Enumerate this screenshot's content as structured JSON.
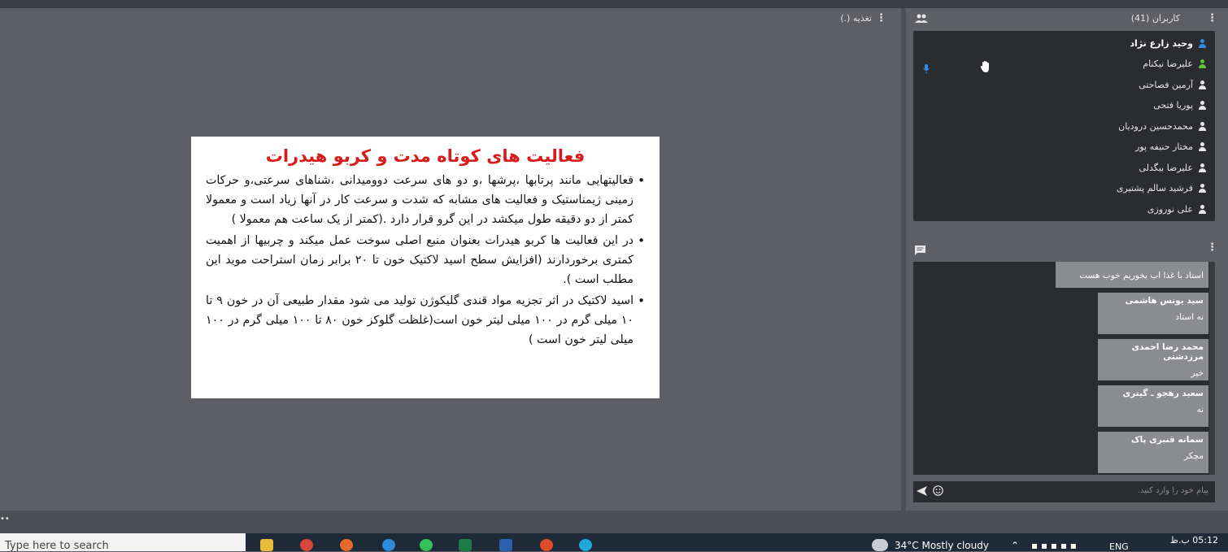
{
  "main": {
    "title": "تغذیه (.)"
  },
  "slide": {
    "title": "فعالیت های کوتاه مدت و کربو هیدرات",
    "bullets": [
      "فعالیتهایی مانند پرتابها ،پرشها ،و دو های سرعت دوومیدانی ،شناهای سرعتی،و حرکات زمینی ژیمناستیک و فعالیت های مشابه که شدت و سرعت کار در آنها زیاد است و معمولا کمتر از دو دقیقه طول میکشد در این گرو قرار دارد .(کمتر از یک ساعت هم معمولا )",
      "در این فعالیت ها کربو هیدرات بعنوان منبع اصلی سوخت عمل میکند و چربیها از اهمیت کمتری برخوردارند (افزایش سطح اسید لاکتیک خون تا ۲۰ برابر زمان استراحت موید این مطلب است ).",
      "اسید لاکتیک در اثر تجزیه مواد قندی گلیکوژن تولید می شود مقدار طبیعی آن در خون ۹ تا ۱۰ میلی گرم در ۱۰۰ میلی لیتر خون است(غلظت گلوکز خون ۸۰ تا ۱۰۰ میلی گرم در ۱۰۰ میلی لیتر خون است )"
    ]
  },
  "users": {
    "title": "کاربران (41)",
    "list": [
      {
        "name": "وحید زارع نژاد",
        "color": "#2f8fe6",
        "bold": true
      },
      {
        "name": "علیرضا نیکنام",
        "color": "#5ec43a",
        "bold": false
      },
      {
        "name": "آرمین فصاحتی",
        "color": "#e6e6e6",
        "bold": false
      },
      {
        "name": "پوریا فتحی",
        "color": "#e6e6e6",
        "bold": false
      },
      {
        "name": "محمدحسین درودیان",
        "color": "#e6e6e6",
        "bold": false
      },
      {
        "name": "مختار حنیفه پور",
        "color": "#e6e6e6",
        "bold": false
      },
      {
        "name": "علیرضا بیگدلی",
        "color": "#e6e6e6",
        "bold": false
      },
      {
        "name": "فرشید سالم پشتیری",
        "color": "#e6e6e6",
        "bold": false
      },
      {
        "name": "علی نوروزی",
        "color": "#e6e6e6",
        "bold": false
      }
    ]
  },
  "chat": {
    "messages": [
      {
        "author": "",
        "text": "استاد با غذا اب بخوریم خوب هست"
      },
      {
        "author": "سید یونس هاشمی",
        "text": "نه استاد"
      },
      {
        "author": "محمد رضا احمدی مرزدشتی",
        "text": "خیر"
      },
      {
        "author": "سعید رهجو ـ گیتری",
        "text": "نه"
      },
      {
        "author": "سمانه قنبری پاک",
        "text": "مچکر"
      }
    ],
    "input_placeholder": "پیام خود را وارد کنید."
  },
  "taskbar": {
    "search_placeholder": "Type here to search",
    "weather": "34°C  Mostly cloudy",
    "lang": "ENG",
    "time": "05:12 ب.ظ"
  },
  "colors": {
    "slide_title": "#d81b1b",
    "accent_blue": "#2f8fe6",
    "accent_green": "#5ec43a"
  }
}
